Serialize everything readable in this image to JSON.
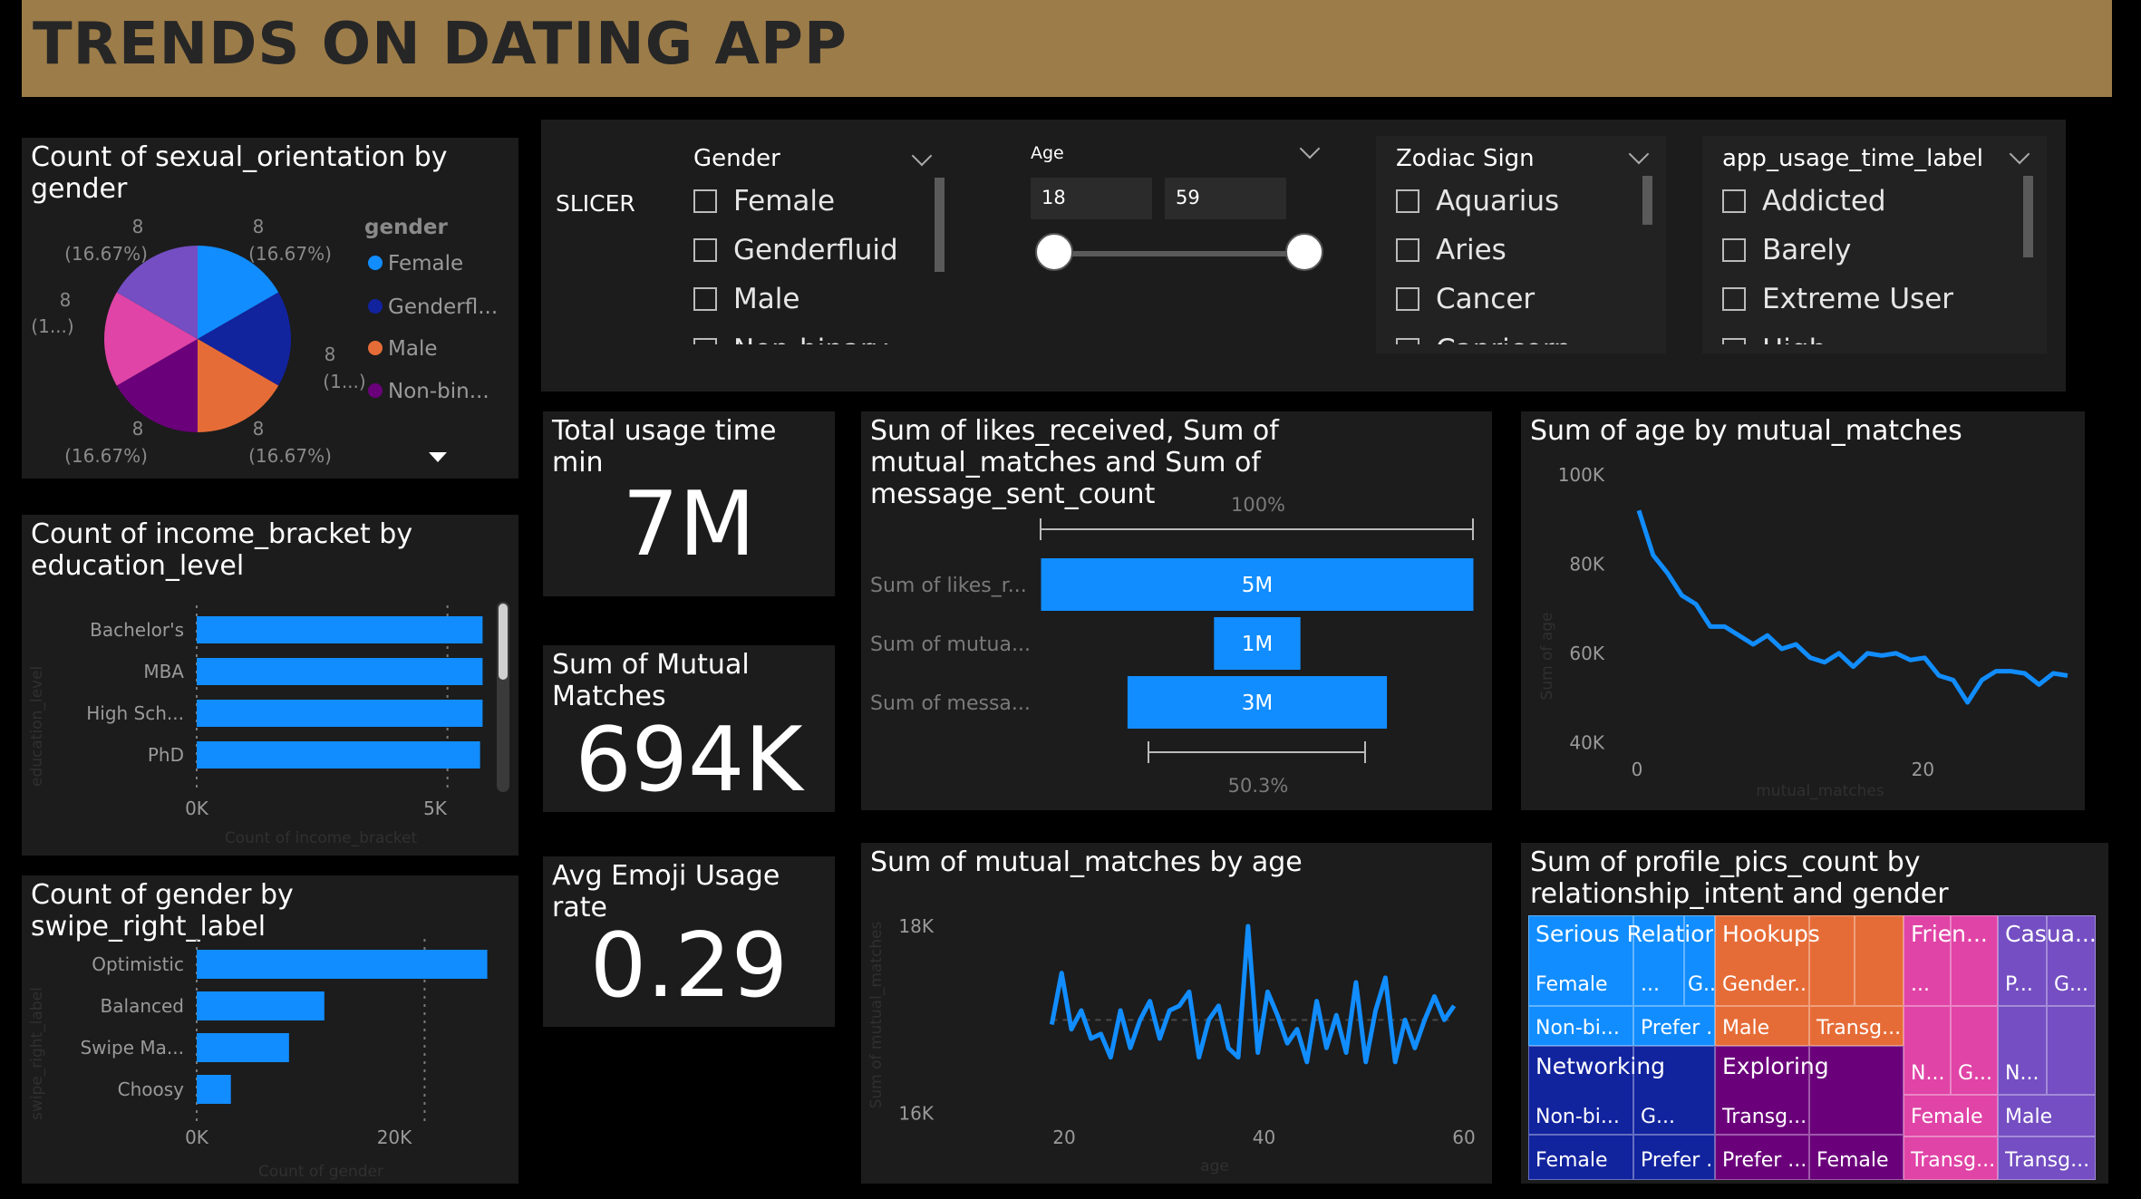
{
  "header": {
    "title": "TRENDS ON DATING APP"
  },
  "slicer_panel": {
    "label": "SLICER",
    "gender": {
      "title": "Gender",
      "options": [
        "Female",
        "Genderfluid",
        "Male",
        "Non-binary"
      ]
    },
    "age": {
      "title": "Age",
      "min_value": "18",
      "max_value": "59"
    },
    "zodiac": {
      "title": "Zodiac Sign",
      "options": [
        "Aquarius",
        "Aries",
        "Cancer",
        "Capricorn"
      ]
    },
    "usage": {
      "title": "app_usage_time_label",
      "options": [
        "Addicted",
        "Barely",
        "Extreme User",
        "High"
      ]
    }
  },
  "pie": {
    "title": "Count of sexual_orientation by gender",
    "legend_title": "gender",
    "legend": [
      {
        "name": "Female",
        "color": "#118dff"
      },
      {
        "name": "Genderfl...",
        "color": "#12239e"
      },
      {
        "name": "Male",
        "color": "#e66c37"
      },
      {
        "name": "Non-bin...",
        "color": "#6b007b"
      }
    ],
    "labels": {
      "l1_val": "8",
      "l1_pct": "(16.67%)",
      "l2_val": "8",
      "l2_pct": "(16.67%)",
      "l3_val": "8",
      "l3_pct": "(1...)",
      "l4_val": "8",
      "l4_pct": "(1...)",
      "l5_val": "8",
      "l5_pct": "(16.67%)",
      "l6_val": "8",
      "l6_pct": "(16.67%)"
    }
  },
  "income_chart": {
    "title": "Count of income_bracket by education_level",
    "xlabel": "Count of income_bracket",
    "ylabel": "education_level",
    "ticks": [
      "0K",
      "5K"
    ]
  },
  "swipe_chart": {
    "title": "Count of gender by swipe_right_label",
    "xlabel": "Count of gender",
    "ylabel": "swipe_right_label",
    "ticks": [
      "0K",
      "20K"
    ]
  },
  "kpis": {
    "usage": {
      "title": "Total usage time min",
      "value": "7M"
    },
    "matches": {
      "title": "Sum of Mutual Matches",
      "value": "694K"
    },
    "emoji": {
      "title": "Avg Emoji Usage rate",
      "value": "0.29"
    }
  },
  "funnel": {
    "title": "Sum of likes_received, Sum of mutual_matches and Sum of message_sent_count",
    "top_pct": "100%",
    "bottom_pct": "50.3%"
  },
  "age_line": {
    "title": "Sum of age by mutual_matches",
    "xlabel": "mutual_matches",
    "ylabel": "Sum of age"
  },
  "matches_line": {
    "title": "Sum of mutual_matches by age",
    "xlabel": "age",
    "ylabel": "Sum of mutual_matches"
  },
  "treemap": {
    "title": "Sum of profile_pics_count by relationship_intent and gender",
    "cells": {
      "serious": "Serious Relation...",
      "hookups": "Hookups",
      "friends": "Frien...",
      "casual": "Casua...",
      "s_female": "Female",
      "s_dots": "...",
      "s_g": "G...",
      "s_nonbi": "Non-bi...",
      "s_prefer": "Prefer ...",
      "h_gender": "Gender...",
      "h_male": "Male",
      "h_transg": "Transg...",
      "f_dots": "...",
      "f_n": "N...",
      "f_g": "G...",
      "f_female": "Female",
      "f_transg": "Transg...",
      "c_p": "P...",
      "c_g": "G...",
      "c_n": "N...",
      "c_male": "Male",
      "c_transg": "Transg...",
      "networking": "Networking",
      "n_nonbi": "Non-bi...",
      "n_g": "G...",
      "n_female": "Female",
      "n_prefer": "Prefer ...",
      "exploring": "Exploring",
      "e_transg": "Transg...",
      "e_prefer": "Prefer ...",
      "e_female": "Female"
    }
  },
  "chart_data": [
    {
      "type": "pie",
      "title": "Count of sexual_orientation by gender",
      "legend_title": "gender",
      "slices": [
        {
          "name": "Female",
          "value": 8,
          "color": "#118dff"
        },
        {
          "name": "Genderfluid",
          "value": 8,
          "color": "#12239e"
        },
        {
          "name": "Male",
          "value": 8,
          "color": "#e66c37"
        },
        {
          "name": "Non-binary",
          "value": 8,
          "color": "#6b007b"
        },
        {
          "name": "",
          "value": 8,
          "color": "#e044a7"
        },
        {
          "name": "",
          "value": 8,
          "color": "#744ec2"
        }
      ]
    },
    {
      "type": "bar",
      "orientation": "horizontal",
      "title": "Count of income_bracket by education_level",
      "categories": [
        "Bachelor's",
        "MBA",
        "High Sch...",
        "PhD"
      ],
      "values": [
        5700,
        5700,
        5700,
        5650
      ],
      "xlabel": "Count of income_bracket",
      "ylabel": "education_level",
      "xlim": [
        0,
        6000
      ]
    },
    {
      "type": "bar",
      "orientation": "horizontal",
      "title": "Count of gender by swipe_right_label",
      "categories": [
        "Optimistic",
        "Balanced",
        "Swipe Ma...",
        "Choosy"
      ],
      "values": [
        25500,
        11200,
        8100,
        3000
      ],
      "xlabel": "Count of gender",
      "ylabel": "swipe_right_label",
      "xlim": [
        0,
        28000
      ]
    },
    {
      "type": "bar",
      "subtype": "funnel",
      "title": "Sum of likes_received, Sum of mutual_matches and Sum of message_sent_count",
      "categories": [
        "Sum of likes_r...",
        "Sum of mutua...",
        "Sum of messa..."
      ],
      "values": [
        5.0,
        1.0,
        3.0
      ],
      "value_labels": [
        "5M",
        "1M",
        "3M"
      ]
    },
    {
      "type": "line",
      "title": "Sum of age by mutual_matches",
      "xlabel": "mutual_matches",
      "ylabel": "Sum of age",
      "x": [
        0,
        1,
        2,
        3,
        4,
        5,
        6,
        7,
        8,
        9,
        10,
        11,
        12,
        13,
        14,
        15,
        16,
        17,
        18,
        19,
        20,
        21,
        22,
        23,
        24,
        25,
        26,
        27,
        28,
        29,
        30
      ],
      "y": [
        92000,
        82000,
        78000,
        73000,
        71000,
        66000,
        66000,
        64000,
        62000,
        64000,
        61000,
        62000,
        59000,
        58000,
        60000,
        57000,
        60000,
        59500,
        60000,
        58500,
        59000,
        55000,
        54000,
        49000,
        54000,
        56000,
        56000,
        55500,
        53000,
        55500,
        55000
      ],
      "yticks": [
        "40K",
        "60K",
        "80K",
        "100K"
      ],
      "xticks": [
        "0",
        "20"
      ],
      "ylim": [
        35000,
        102000
      ]
    },
    {
      "type": "line",
      "title": "Sum of mutual_matches by age",
      "xlabel": "age",
      "ylabel": "Sum of mutual_matches",
      "x": [
        18,
        19,
        20,
        21,
        22,
        23,
        24,
        25,
        26,
        27,
        28,
        29,
        30,
        31,
        32,
        33,
        34,
        35,
        36,
        37,
        38,
        39,
        40,
        41,
        42,
        43,
        44,
        45,
        46,
        47,
        48,
        49,
        50,
        51,
        52,
        53,
        54,
        55,
        56,
        57,
        58,
        59
      ],
      "y": [
        16950,
        17500,
        16900,
        17100,
        16800,
        16850,
        16600,
        17100,
        16700,
        17000,
        17200,
        16800,
        17100,
        17150,
        17300,
        16600,
        17000,
        17150,
        16700,
        16600,
        18000,
        16650,
        17300,
        17050,
        16750,
        16900,
        16550,
        17200,
        16700,
        17050,
        16650,
        17400,
        16550,
        17100,
        17450,
        16550,
        17000,
        16700,
        17000,
        17250,
        17000,
        17150
      ],
      "reference_y": 17000,
      "yticks": [
        "16K",
        "18K"
      ],
      "xticks": [
        "20",
        "40",
        "60"
      ],
      "ylim": [
        15600,
        18600
      ],
      "xlim": [
        16,
        60
      ]
    },
    {
      "type": "treemap",
      "title": "Sum of profile_pics_count by relationship_intent and gender",
      "groups": [
        "Serious Relation...",
        "Hookups",
        "Frien...",
        "Casua...",
        "Networking",
        "Exploring"
      ]
    }
  ]
}
